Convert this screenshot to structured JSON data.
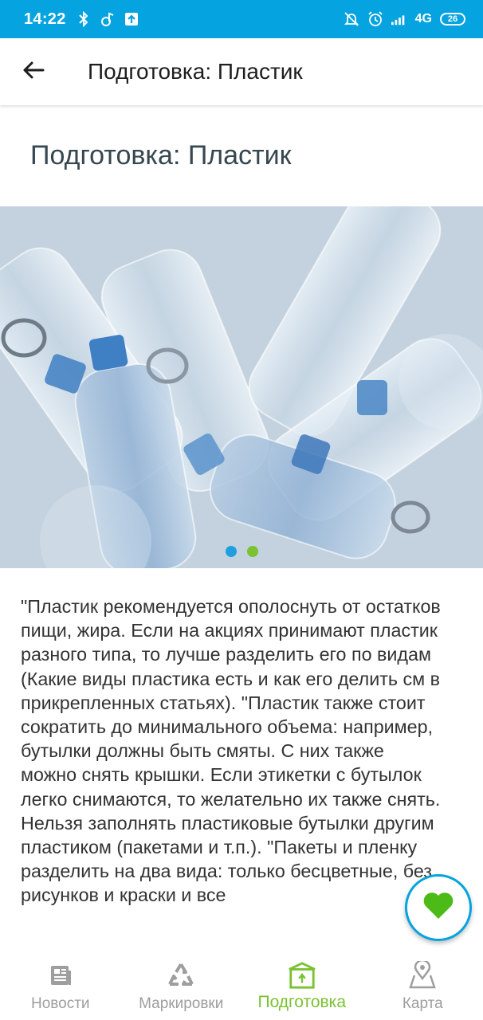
{
  "status_bar": {
    "time": "14:22",
    "left_icons": [
      "bluetooth-icon",
      "music-note-icon",
      "upload-icon"
    ],
    "right_icons": [
      "bell-off-icon",
      "alarm-icon",
      "signal-icon"
    ],
    "network": "4G",
    "battery": "26",
    "background_color": "#05A3E0"
  },
  "app_bar": {
    "back_icon": "arrow-left-icon",
    "title": "Подготовка: Пластик"
  },
  "page": {
    "heading": "Подготовка: Пластик",
    "carousel": {
      "image_subject": "plastic-bottles",
      "dots": [
        {
          "color": "#1E9FE0",
          "active": true
        },
        {
          "color": "#7AC231",
          "active": false
        }
      ]
    },
    "body_text": "\"Пластик рекомендуется ополоснуть от остатков пищи, жира. Если на акциях принимают пластик разного типа, то лучше разделить его по видам (Какие виды пластика есть и как его делить см в прикрепленных статьях).  \"Пластик также стоит сократить до минимального объема: например, бутылки должны быть смяты. С них также можно снять крышки. Если этикетки с бутылок легко снимаются, то желательно их также снять. Нельзя заполнять пластиковые бутылки другим пластиком (пакетами и т.п.). \"Пакеты и пленку разделить на два вида: только бесцветные, без рисунков и краски и все"
  },
  "fab": {
    "icon": "heart-icon",
    "icon_color": "#4CBB17",
    "border_color": "#05A3E0"
  },
  "bottom_nav": {
    "items": [
      {
        "label": "Новости",
        "icon": "newspaper-icon",
        "active": false
      },
      {
        "label": "Маркировки",
        "icon": "recycle-icon",
        "active": false
      },
      {
        "label": "Подготовка",
        "icon": "box-icon",
        "active": true
      },
      {
        "label": "Карта",
        "icon": "map-pin-icon",
        "active": false
      }
    ],
    "active_color": "#7AC231",
    "inactive_color": "#9E9E9E"
  }
}
